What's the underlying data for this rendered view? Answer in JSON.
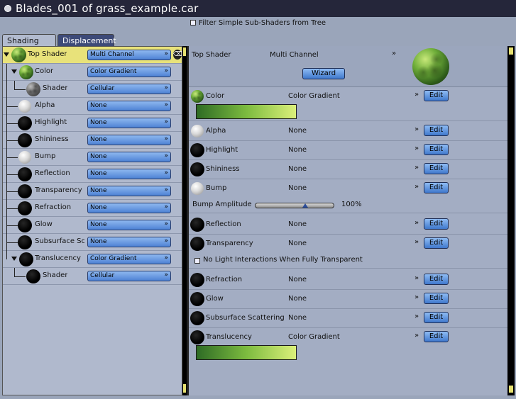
{
  "window": {
    "title": "Blades_001 of grass_example.car"
  },
  "filter": {
    "label": "Filter Simple Sub-Shaders from Tree",
    "checked": false
  },
  "tabs": [
    {
      "label": "Shading",
      "active": true
    },
    {
      "label": "Displacement",
      "active": false
    }
  ],
  "tree": {
    "rows": [
      {
        "label": "Top Shader",
        "value": "Multi Channel",
        "ball": "green",
        "selected": true
      },
      {
        "label": "Color",
        "value": "Color Gradient",
        "ball": "green"
      },
      {
        "label": "Shader",
        "value": "Cellular",
        "ball": "cellular"
      },
      {
        "label": "Alpha",
        "value": "None",
        "ball": "white"
      },
      {
        "label": "Highlight",
        "value": "None",
        "ball": "black"
      },
      {
        "label": "Shininess",
        "value": "None",
        "ball": "black"
      },
      {
        "label": "Bump",
        "value": "None",
        "ball": "white"
      },
      {
        "label": "Reflection",
        "value": "None",
        "ball": "black"
      },
      {
        "label": "Transparency",
        "value": "None",
        "ball": "black"
      },
      {
        "label": "Refraction",
        "value": "None",
        "ball": "black"
      },
      {
        "label": "Glow",
        "value": "None",
        "ball": "black"
      },
      {
        "label": "Subsurface Sc",
        "value": "None",
        "ball": "black"
      },
      {
        "label": "Translucency",
        "value": "Color Gradient",
        "ball": "black"
      },
      {
        "label": "Shader",
        "value": "Cellular",
        "ball": "black"
      }
    ],
    "dropdown_arrow": "»",
    "trash_icon": "trash-icon"
  },
  "top_shader": {
    "label": "Top Shader",
    "value": "Multi Channel",
    "chevron": "»",
    "wizard_label": "Wizard"
  },
  "channels": {
    "edit_label": "Edit",
    "chevron": "»",
    "color": {
      "label": "Color",
      "value": "Color Gradient"
    },
    "alpha": {
      "label": "Alpha",
      "value": "None"
    },
    "highlight": {
      "label": "Highlight",
      "value": "None"
    },
    "shininess": {
      "label": "Shininess",
      "value": "None"
    },
    "bump": {
      "label": "Bump",
      "value": "None"
    },
    "bump_amplitude": {
      "label": "Bump Amplitude",
      "value": "100%",
      "level": 0.65
    },
    "reflection": {
      "label": "Reflection",
      "value": "None"
    },
    "transparency": {
      "label": "Transparency",
      "value": "None"
    },
    "no_light": {
      "label": "No Light Interactions When Fully Transparent",
      "checked": false
    },
    "refraction": {
      "label": "Refraction",
      "value": "None"
    },
    "glow": {
      "label": "Glow",
      "value": "None"
    },
    "subsurface": {
      "label": "Subsurface Scattering",
      "value": "None"
    },
    "translucency": {
      "label": "Translucency",
      "value": "Color Gradient"
    }
  },
  "colors": {
    "titlebar": "#25263a",
    "selected_row": "#e8e27a",
    "button_blue": "#4d82d4",
    "gradient_start": "#2e6b25",
    "gradient_end": "#dcf07a"
  }
}
